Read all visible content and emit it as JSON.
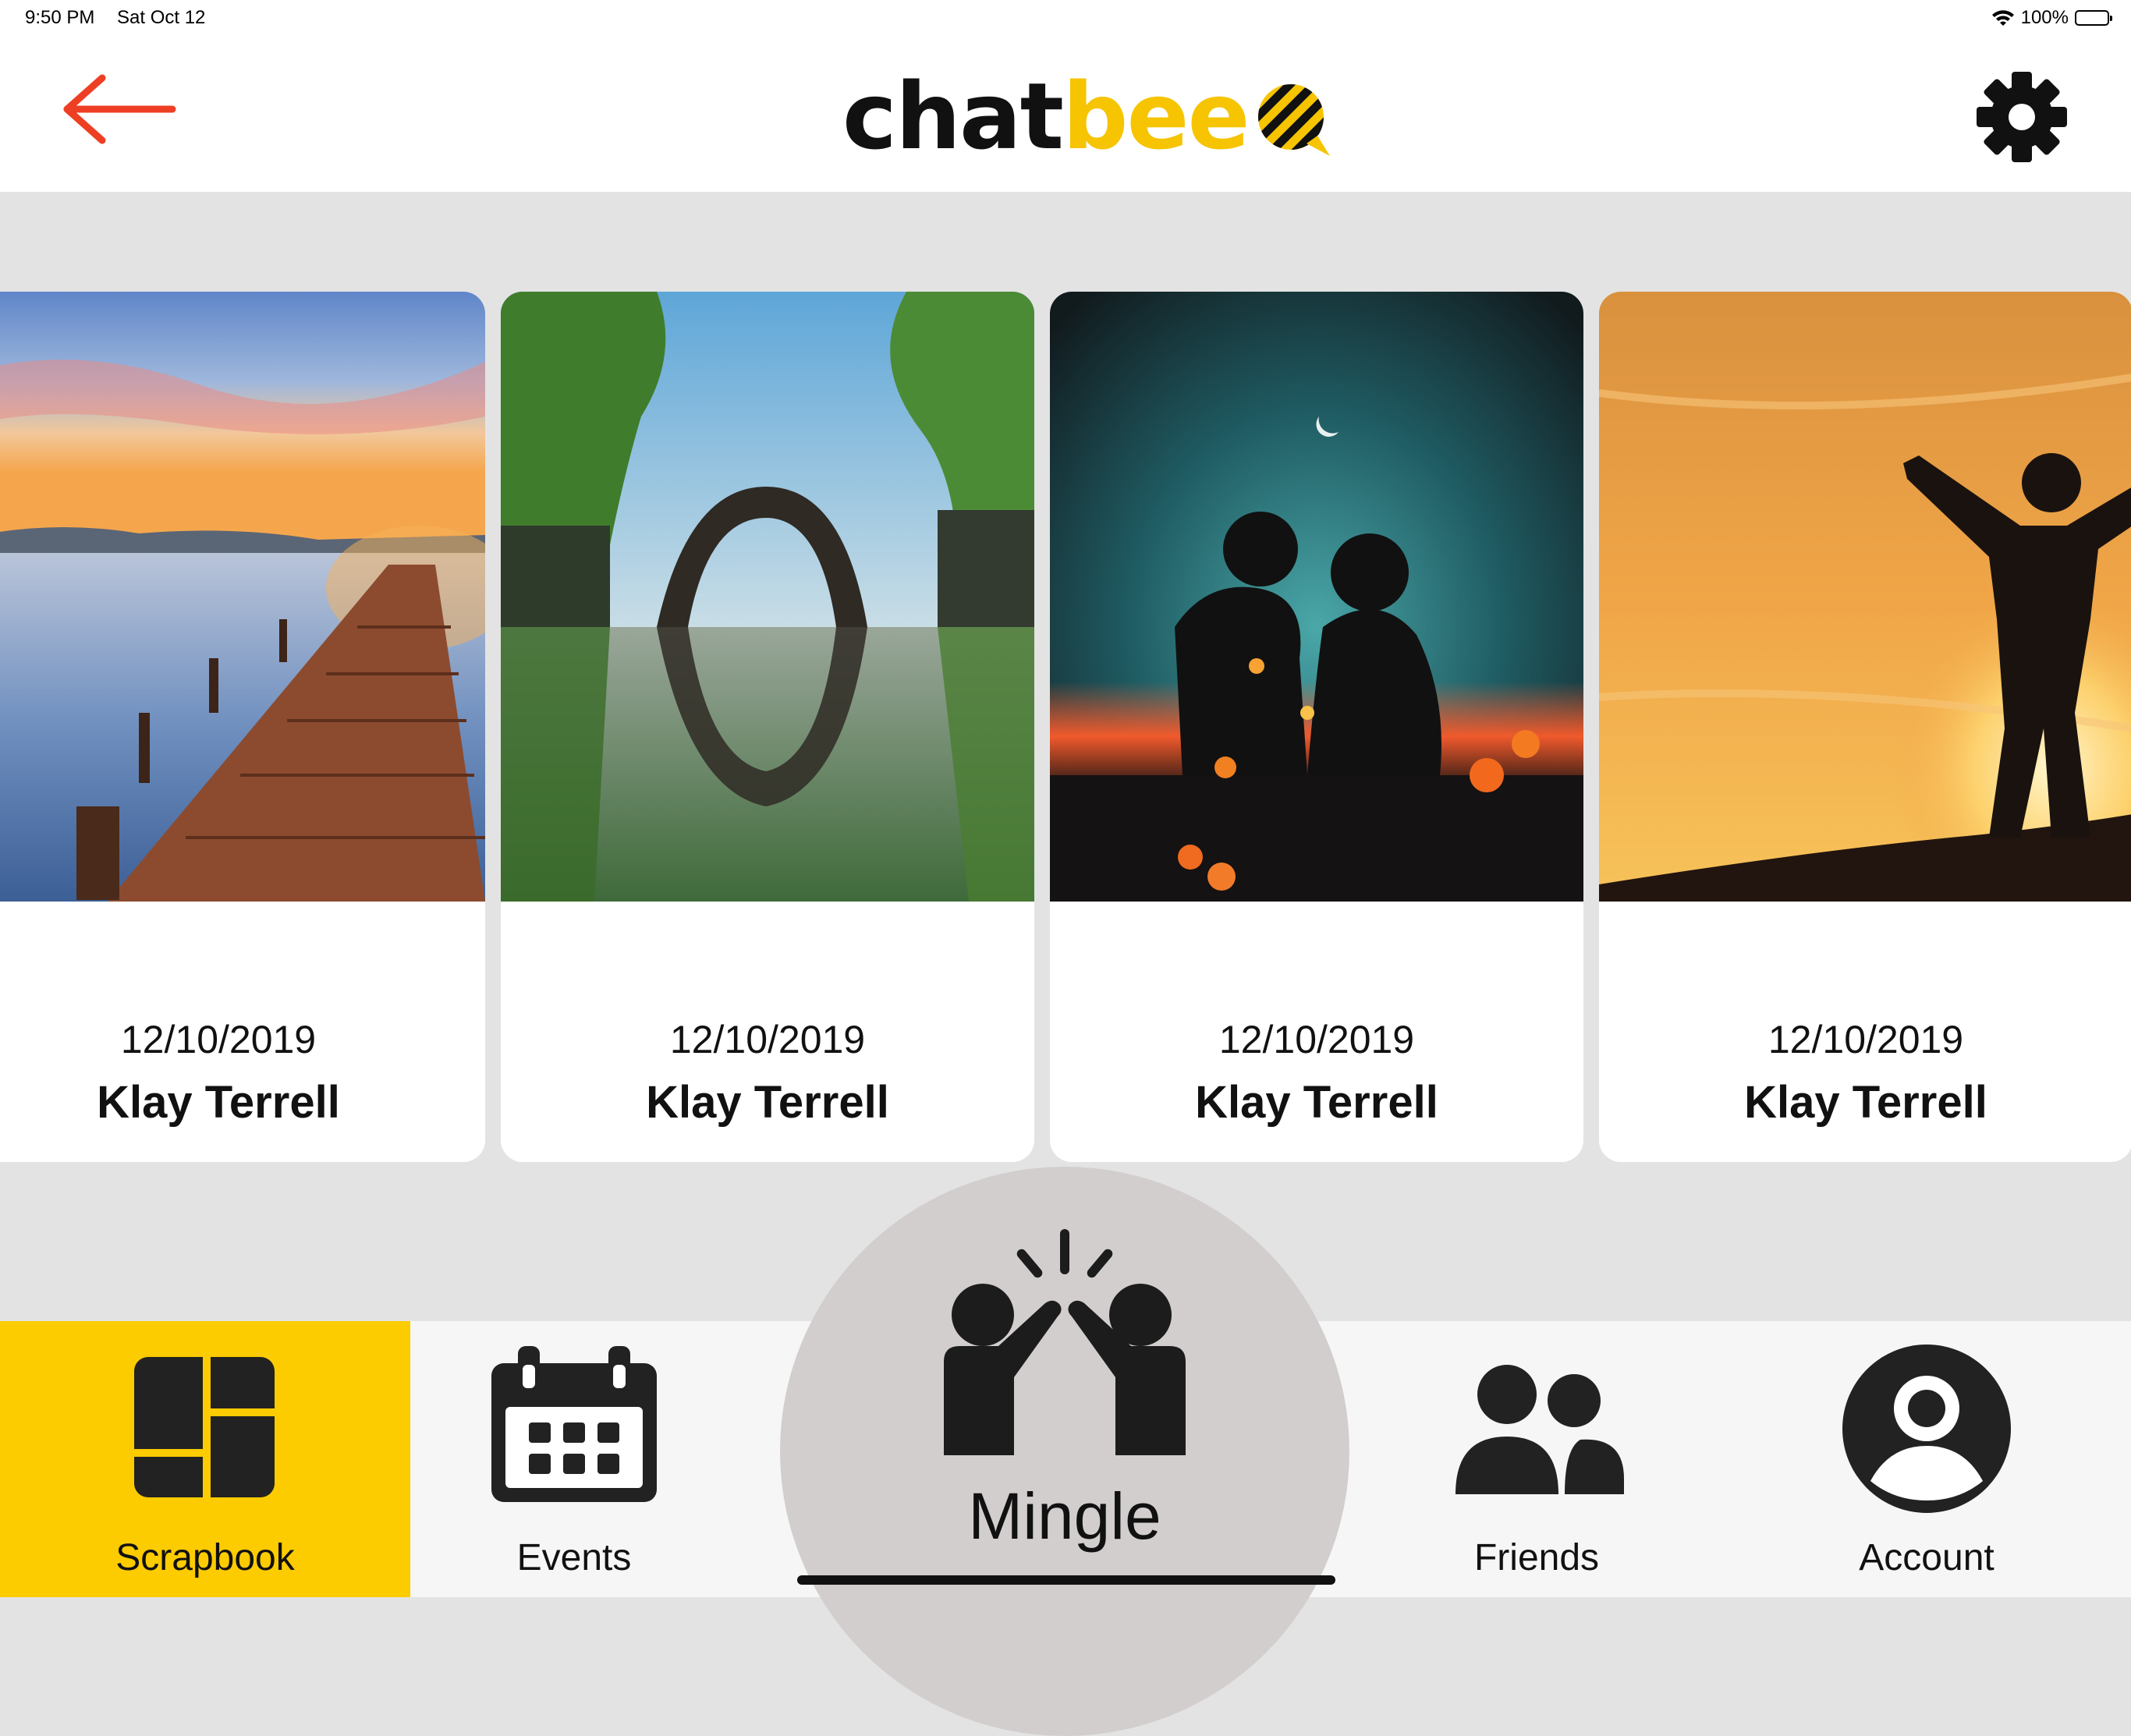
{
  "status_bar": {
    "time": "9:50 PM",
    "date": "Sat Oct 12",
    "battery": "100%",
    "icons": [
      "wifi-icon",
      "battery-icon"
    ]
  },
  "header": {
    "logo_part1": "chat",
    "logo_part2": "bee",
    "back_icon": "arrow-left-icon",
    "settings_icon": "gear-icon",
    "colors": {
      "back_arrow": "#ee3f24",
      "brand_yellow": "#f6c400"
    }
  },
  "cards": [
    {
      "date": "12/10/2019",
      "name": "Klay Terrell",
      "image": "pier-sunset"
    },
    {
      "date": "12/10/2019",
      "name": "Klay Terrell",
      "image": "arch-bridge-reflection"
    },
    {
      "date": "12/10/2019",
      "name": "Klay Terrell",
      "image": "couple-silhouette"
    },
    {
      "date": "12/10/2019",
      "name": "Klay Terrell",
      "image": "hiker-silhouette-sunset"
    }
  ],
  "tabs": {
    "scrapbook": "Scrapbook",
    "events": "Events",
    "mingle": "Mingle",
    "friends": "Friends",
    "account": "Account",
    "active": "Scrapbook",
    "colors": {
      "active_bg": "#fccb00",
      "mingle_bg": "#d2cecd"
    }
  }
}
